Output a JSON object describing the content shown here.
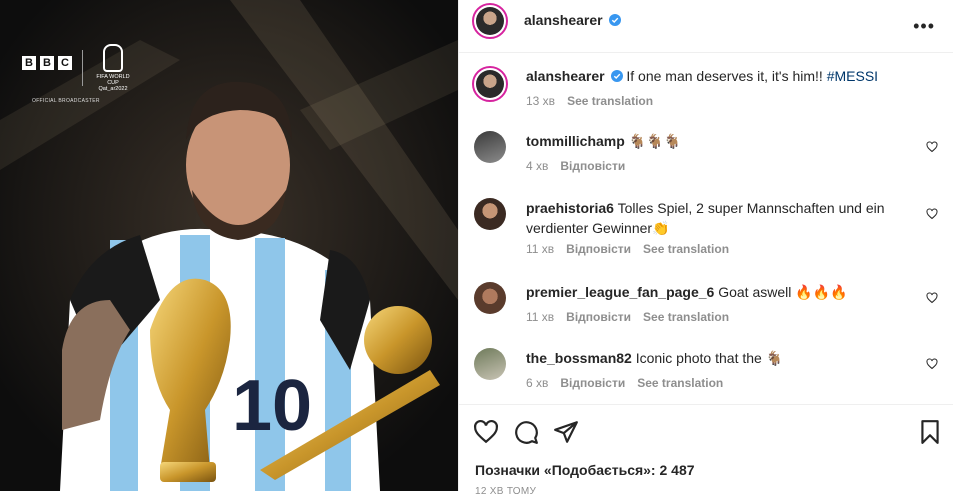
{
  "media": {
    "broadcaster": [
      "B",
      "B",
      "C"
    ],
    "broadcaster_sub": "OFFICIAL BROADCASTER",
    "event_line1": "FIFA WORLD CUP",
    "event_line2": "Qat_ar2022"
  },
  "post_header": {
    "username": "alanshearer",
    "verified": true,
    "more_icon": "more-horizontal-icon"
  },
  "caption": {
    "username": "alanshearer",
    "text": "If one man deserves it, it's him!!",
    "hashtag": "#MESSI",
    "time": "13 хв",
    "see_translation": "See translation"
  },
  "comments": [
    {
      "username": "tommillichamp",
      "text": "🐐🐐🐐",
      "time": "4 хв",
      "reply": "Відповісти",
      "see_translation": ""
    },
    {
      "username": "praehistoria6",
      "text": "Tolles Spiel, 2 super Mannschaften und ein verdienter Gewinner👏",
      "time": "11 хв",
      "reply": "Відповісти",
      "see_translation": "See translation"
    },
    {
      "username": "premier_league_fan_page_6",
      "text": "Goat aswell 🔥🔥🔥",
      "time": "11 хв",
      "reply": "Відповісти",
      "see_translation": "See translation"
    },
    {
      "username": "the_bossman82",
      "text": "Iconic photo that the 🐐",
      "time": "6 хв",
      "reply": "Відповісти",
      "see_translation": "See translation"
    }
  ],
  "footer": {
    "likes_label": "Позначки «Подобається»: 2 487",
    "posted_ago": "12 ХВ ТОМУ",
    "icons": [
      "heart-icon",
      "comment-icon",
      "share-icon",
      "bookmark-icon"
    ]
  },
  "colors": {
    "verified": "#3897f0",
    "hashtag": "#00376b",
    "secondary_text": "#8e8e8e",
    "story_ring": "#d6249f"
  }
}
